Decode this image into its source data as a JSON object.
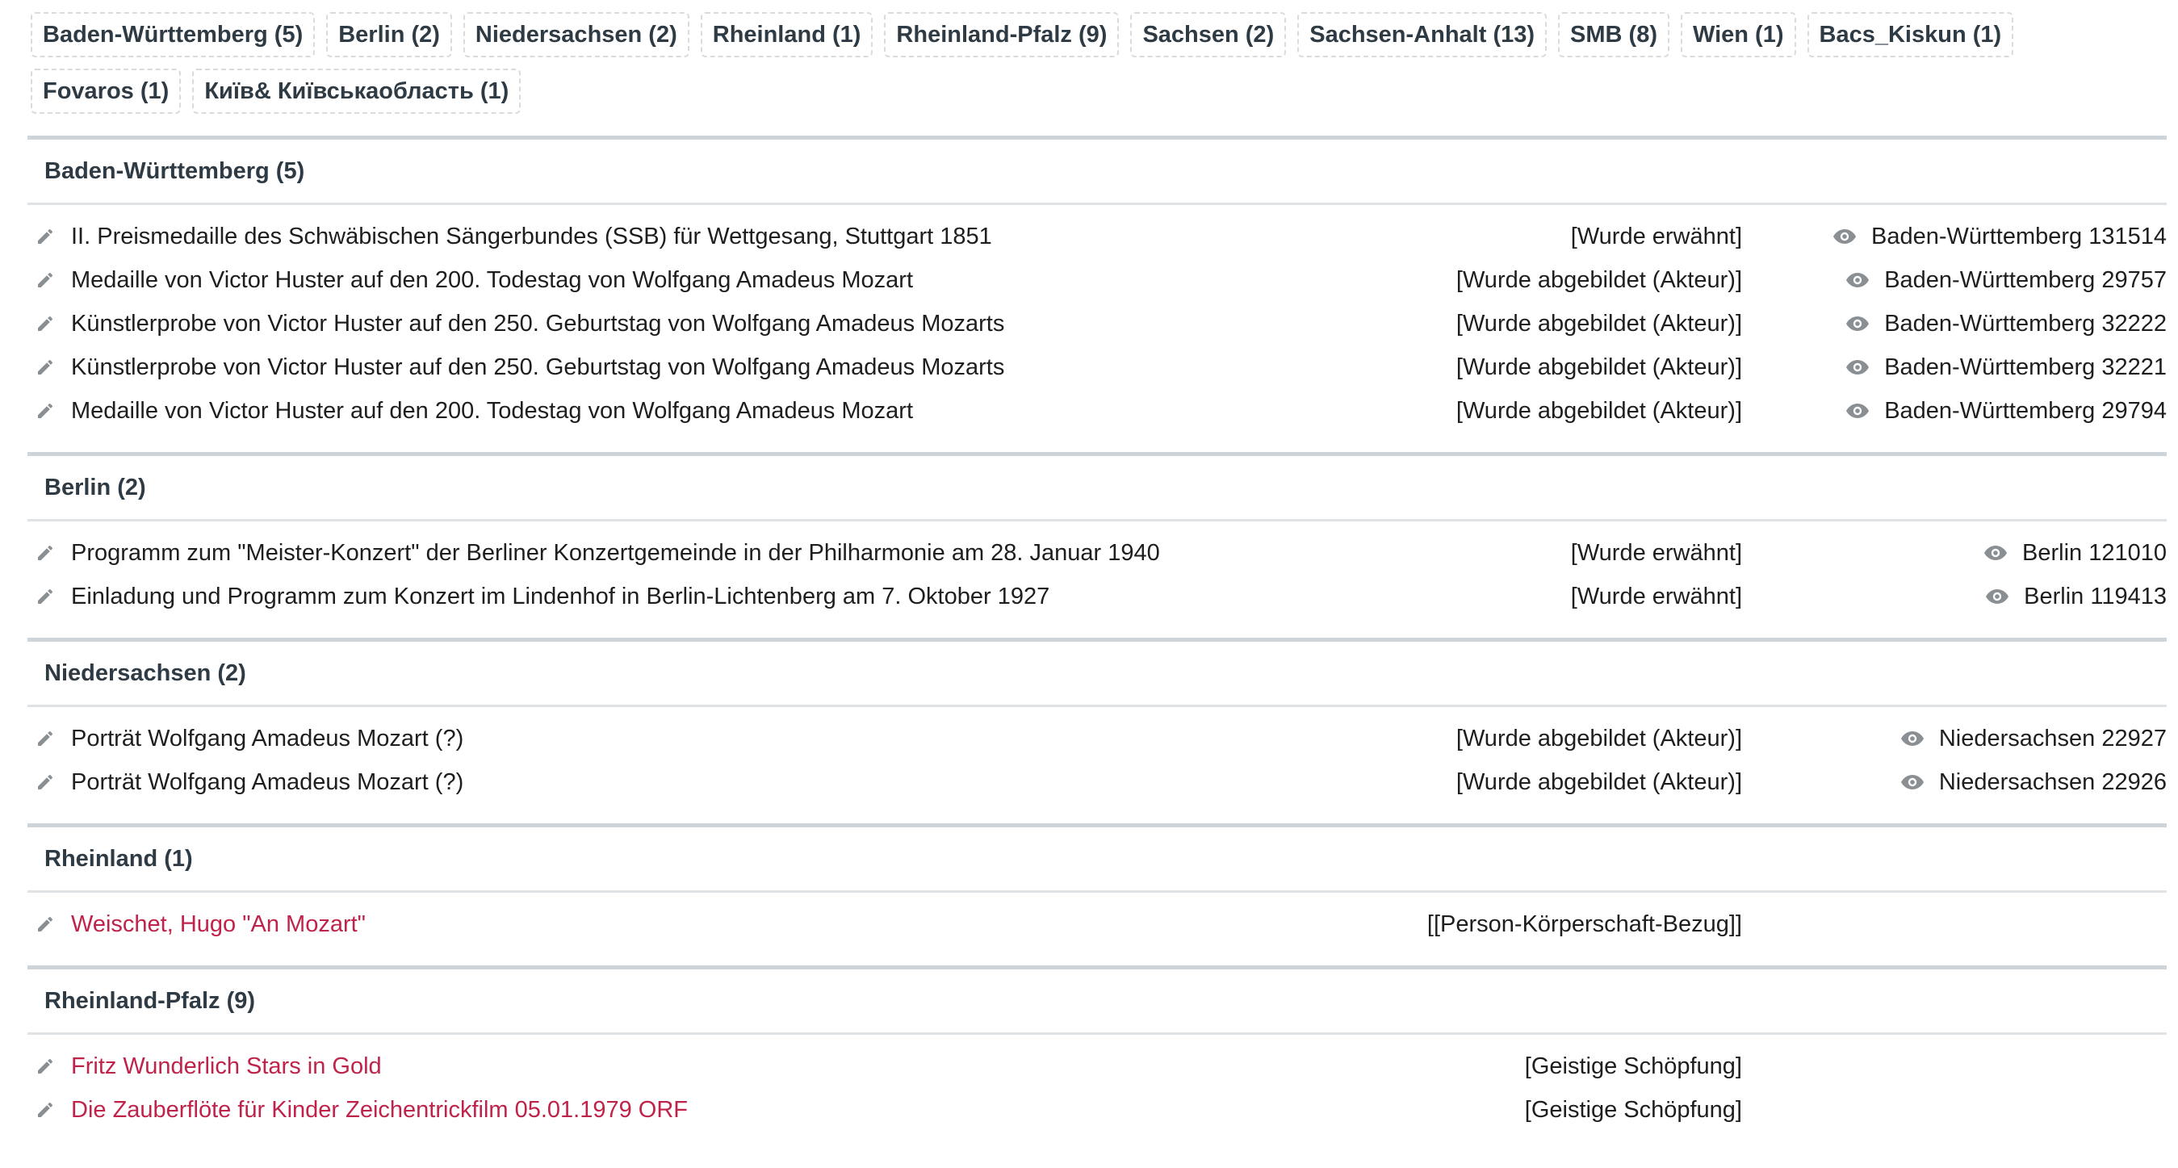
{
  "tags": [
    "Baden-Württemberg (5)",
    "Berlin (2)",
    "Niedersachsen (2)",
    "Rheinland (1)",
    "Rheinland-Pfalz (9)",
    "Sachsen (2)",
    "Sachsen-Anhalt (13)",
    "SMB (8)",
    "Wien (1)",
    "Bacs_Kiskun (1)",
    "Fovaros (1)",
    "Київ& Київськаобласть (1)"
  ],
  "icons": {
    "edit": "pencil-icon",
    "view": "eye-icon"
  },
  "colors": {
    "link": "#c0234a",
    "icon": "#8a8f93",
    "divider": "#cdd5da"
  },
  "sections": [
    {
      "title": "Baden-Württemberg (5)",
      "rows": [
        {
          "title": "II. Preismedaille des Schwäbischen Sängerbundes (SSB) für Wettgesang, Stuttgart 1851",
          "relation": "[Wurde erwähnt]",
          "ref": "Baden-Württemberg 131514"
        },
        {
          "title": "Medaille von Victor Huster auf den 200. Todestag von Wolfgang Amadeus Mozart",
          "relation": "[Wurde abgebildet (Akteur)]",
          "ref": "Baden-Württemberg 29757"
        },
        {
          "title": "Künstlerprobe von Victor Huster auf den 250. Geburtstag von Wolfgang Amadeus Mozarts",
          "relation": "[Wurde abgebildet (Akteur)]",
          "ref": "Baden-Württemberg 32222"
        },
        {
          "title": "Künstlerprobe von Victor Huster auf den 250. Geburtstag von Wolfgang Amadeus Mozarts",
          "relation": "[Wurde abgebildet (Akteur)]",
          "ref": "Baden-Württemberg 32221"
        },
        {
          "title": "Medaille von Victor Huster auf den 200. Todestag von Wolfgang Amadeus Mozart",
          "relation": "[Wurde abgebildet (Akteur)]",
          "ref": "Baden-Württemberg 29794"
        }
      ]
    },
    {
      "title": "Berlin (2)",
      "rows": [
        {
          "title": "Programm zum \"Meister-Konzert\" der Berliner Konzertgemeinde in der Philharmonie am 28. Januar 1940",
          "relation": "[Wurde erwähnt]",
          "ref": "Berlin 121010"
        },
        {
          "title": "Einladung und Programm zum Konzert im Lindenhof in Berlin-Lichtenberg am 7. Oktober 1927",
          "relation": "[Wurde erwähnt]",
          "ref": "Berlin 119413"
        }
      ]
    },
    {
      "title": "Niedersachsen (2)",
      "rows": [
        {
          "title": "Porträt Wolfgang Amadeus Mozart (?)",
          "relation": "[Wurde abgebildet (Akteur)]",
          "ref": "Niedersachsen 22927"
        },
        {
          "title": "Porträt Wolfgang Amadeus Mozart (?)",
          "relation": "[Wurde abgebildet (Akteur)]",
          "ref": "Niedersachsen 22926"
        }
      ]
    },
    {
      "title": "Rheinland (1)",
      "rows": [
        {
          "title": "Weischet, Hugo \"An Mozart\"",
          "relation": "[[Person-Körperschaft-Bezug]]",
          "link": true
        }
      ]
    },
    {
      "title": "Rheinland-Pfalz (9)",
      "rows": [
        {
          "title": "Fritz Wunderlich Stars in Gold",
          "relation": "[Geistige Schöpfung]",
          "link": true
        },
        {
          "title": "Die Zauberflöte für Kinder Zeichentrickfilm 05.01.1979 ORF",
          "relation": "[Geistige Schöpfung]",
          "link": true
        }
      ]
    }
  ]
}
